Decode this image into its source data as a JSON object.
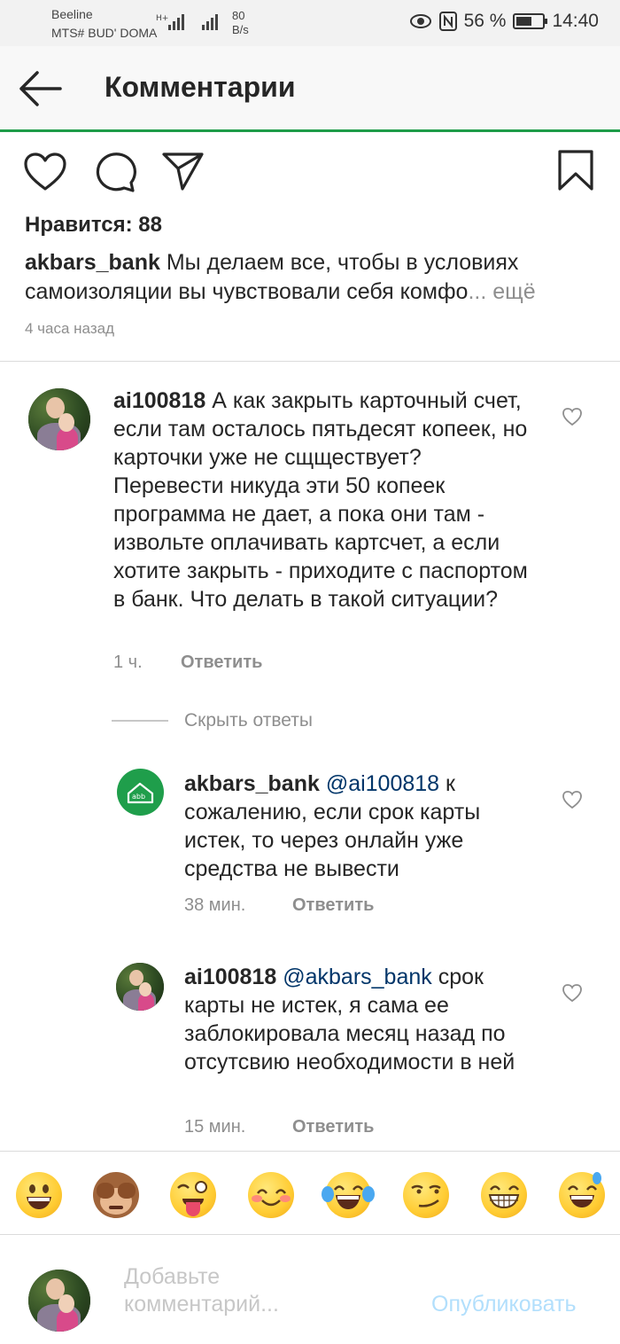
{
  "status_bar": {
    "carrier_1": "Beeline",
    "carrier_2": "MTS# BUD' DOMA",
    "speed_value": "80",
    "speed_unit": "B/s",
    "battery": "56 %",
    "time": "14:40"
  },
  "header": {
    "title": "Комментарии"
  },
  "post": {
    "likes": "Нравится: 88",
    "author": "akbars_bank",
    "caption": " Мы делаем все, чтобы в условиях самоизоляции вы чувствовали себя комфо",
    "more": "... ещё",
    "time": "4 часа назад"
  },
  "comments": [
    {
      "user": "ai100818",
      "text": " А как закрыть карточный счет, если там осталось пятьдесят копеек, но карточки уже не сщществует? Перевести никуда эти 50 копеек программа не дает, а пока они там - извольте оплачивать картсчет, а если хотите закрыть - приходите с паспортом в банк. Что делать в такой ситуации?",
      "time": "1 ч.",
      "reply": "Ответить"
    }
  ],
  "hide_replies": "Скрыть ответы",
  "replies": [
    {
      "user": "akbars_bank",
      "mention": " @ai100818",
      "text": " к сожалению, если срок карты истек, то через онлайн уже средства не вывести",
      "time": "38 мин.",
      "reply": "Ответить"
    },
    {
      "user": "ai100818",
      "mention": " @akbars_bank",
      "text": " срок карты не истек, я сама ее заблокировала месяц назад по отсутсвию необходимости в ней",
      "time": "15 мин.",
      "reply": "Ответить"
    }
  ],
  "emojis": [
    "grinning-face",
    "see-no-evil-monkey",
    "winking-face-with-tongue",
    "smiling-face-with-smiling-eyes",
    "face-with-tears-of-joy",
    "smirking-face",
    "beaming-face",
    "grinning-face-with-sweat"
  ],
  "compose": {
    "placeholder": "Добавьте комментарий...",
    "publish": "Опубликовать"
  },
  "colors": {
    "accent_line": "#1e9c48",
    "bank_avatar": "#1f9e4b",
    "mention": "#003569",
    "publish_disabled": "#b2dffc"
  }
}
